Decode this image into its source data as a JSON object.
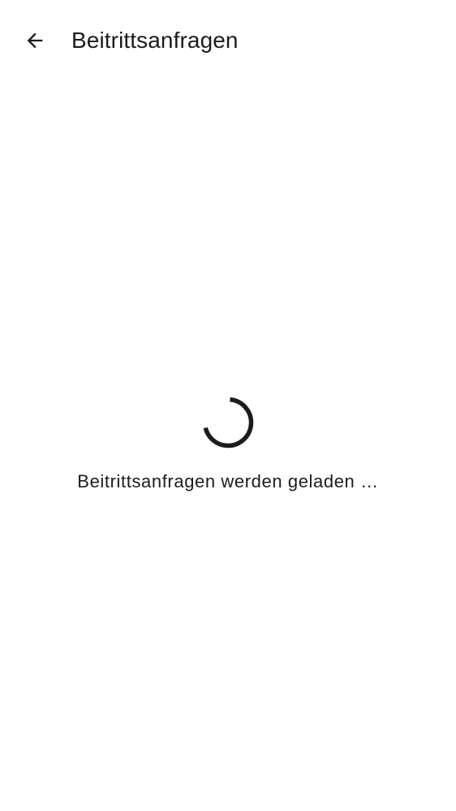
{
  "app_bar": {
    "back_icon": "arrow-back-icon",
    "title": "Beitrittsanfragen"
  },
  "loading": {
    "spinner_icon": "progress-spinner-icon",
    "message": "Beitrittsanfragen werden geladen …"
  },
  "colors": {
    "background": "#ffffff",
    "text": "#1c1b1f",
    "spinner": "#1c1b1f"
  }
}
